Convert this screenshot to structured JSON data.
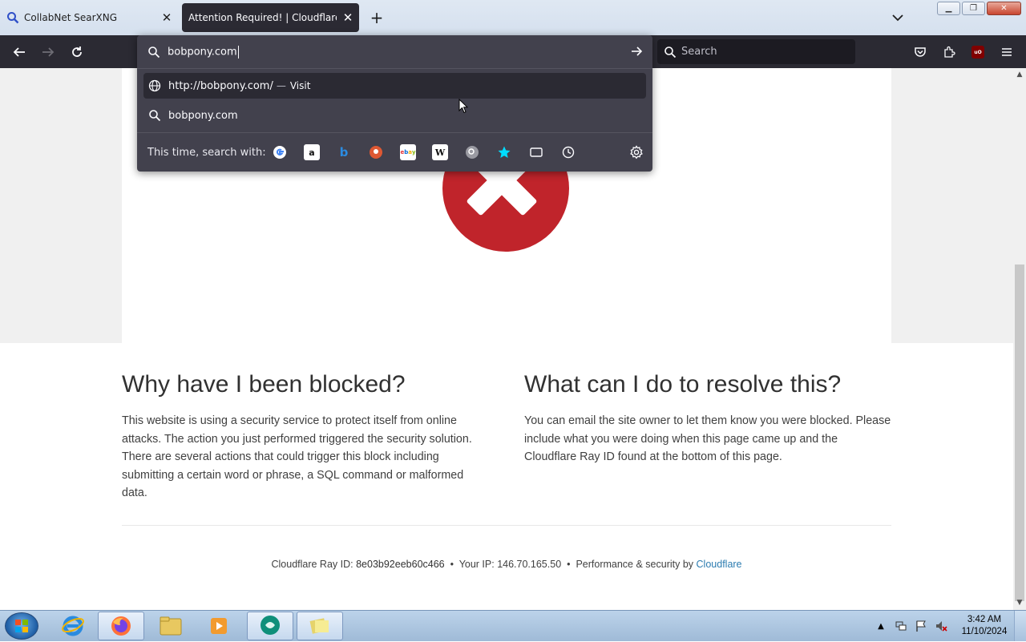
{
  "browser": {
    "tabs": [
      {
        "title": "CollabNet SearXNG",
        "active": false
      },
      {
        "title": "Attention Required! | Cloudflare",
        "active": true
      }
    ],
    "url_value": "bobpony.com",
    "search_placeholder": "Search"
  },
  "url_dropdown": {
    "results": [
      {
        "text": "http://bobpony.com/",
        "separator": "—",
        "action": "Visit",
        "icon": "globe-icon"
      },
      {
        "text": "bobpony.com",
        "icon": "search-icon"
      }
    ],
    "oneoff_label": "This time, search with:",
    "engines": [
      "google",
      "amazon",
      "bing",
      "duckduckgo",
      "ebay",
      "wikipedia",
      "searxng",
      "bookmarks",
      "tabs",
      "history"
    ]
  },
  "page": {
    "left": {
      "heading": "Why have I been blocked?",
      "body": "This website is using a security service to protect itself from online attacks. The action you just performed triggered the security solution. There are several actions that could trigger this block including submitting a certain word or phrase, a SQL command or malformed data."
    },
    "right": {
      "heading": "What can I do to resolve this?",
      "body": "You can email the site owner to let them know you were blocked. Please include what you were doing when this page came up and the Cloudflare Ray ID found at the bottom of this page."
    },
    "footer": {
      "ray_label": "Cloudflare Ray ID:",
      "ray_id": "8e03b92eeb60c466",
      "bullet": "•",
      "ip_label": "Your IP:",
      "ip": "146.70.165.50",
      "perf_label": "Performance & security by",
      "perf_link": "Cloudflare"
    }
  },
  "taskbar": {
    "time": "3:42 AM",
    "date": "11/10/2024"
  },
  "colors": {
    "toolbar_bg": "#2b2a33",
    "dropdown_bg": "#42414d",
    "error_red": "#c0242b",
    "link_blue": "#2c7cb0"
  }
}
